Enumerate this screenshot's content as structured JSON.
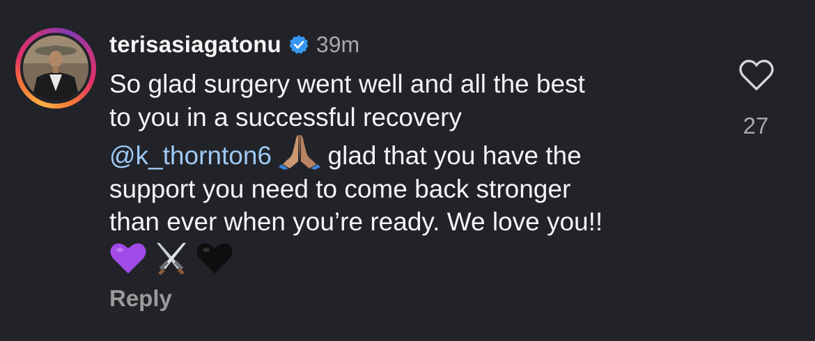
{
  "comment": {
    "username": "terisasiagatonu",
    "verified": true,
    "time": "39m",
    "text_lines": {
      "line1": "So glad surgery went well and all the best",
      "line2": "to you in a successful recovery",
      "mention": "@k_thornton6",
      "line3_rest": "glad that you have the",
      "line4": "support you need to come back stronger",
      "line5": "than ever when you’re ready. We love you!!"
    },
    "emojis": [
      "folded-hands",
      "purple-heart",
      "crossed-swords",
      "black-heart"
    ],
    "reply_label": "Reply",
    "like_count": "27"
  },
  "colors": {
    "background": "#212328",
    "mention": "#9ec9f5",
    "verified": "#3797f0",
    "muted": "#a8a8a8"
  }
}
